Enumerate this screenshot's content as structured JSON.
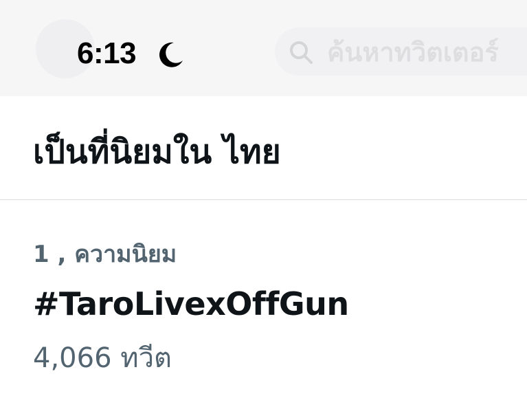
{
  "status_bar": {
    "time": "6:13",
    "focus_icon": "moon-icon"
  },
  "search": {
    "placeholder": "ค้นหาทวิตเตอร์",
    "icon": "search-icon"
  },
  "section": {
    "title": "เป็นที่นิยมใน ไทย"
  },
  "trends": [
    {
      "rank_label": "1 , ความนิยม",
      "name": "#TaroLivexOffGun",
      "tweet_count": "4,066 ทวีต"
    }
  ],
  "colors": {
    "primary_text": "#0f1419",
    "secondary_text": "#536471",
    "divider": "#d9dde0",
    "header_bg": "#f6f6f7"
  }
}
